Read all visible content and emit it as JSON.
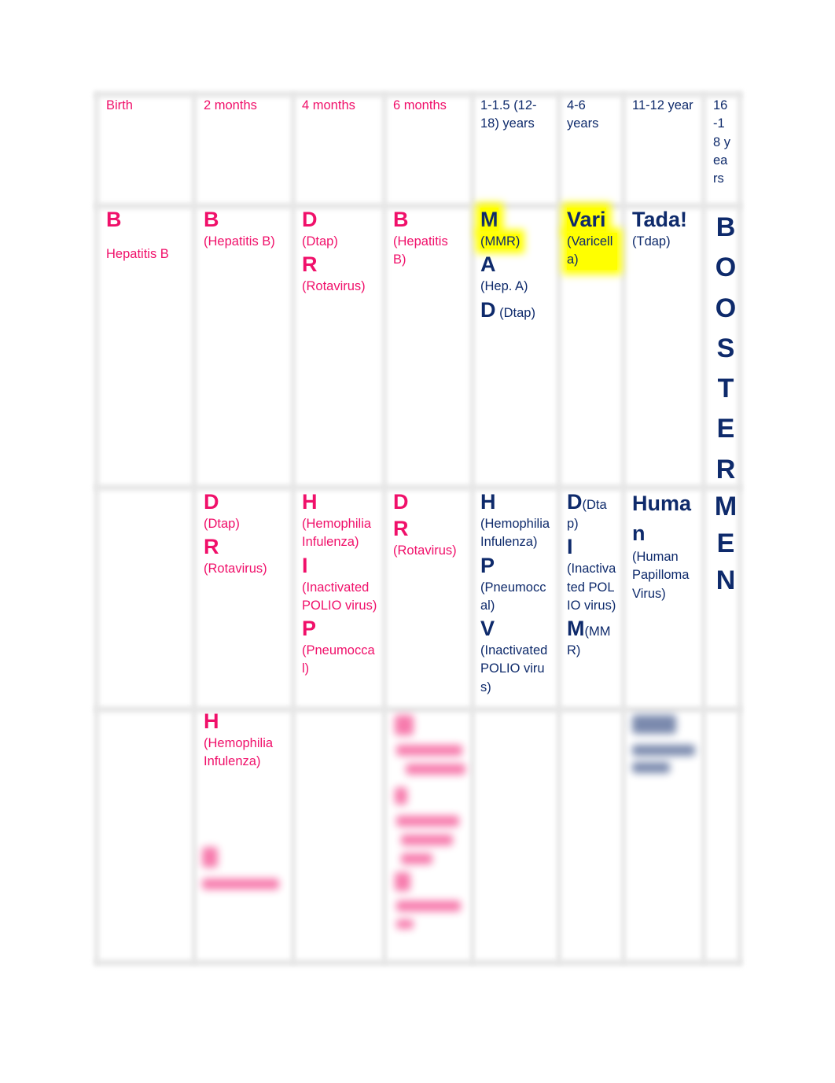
{
  "colors": {
    "pink": "#F0106A",
    "navy": "#0E2A6B",
    "highlight": "#FFFF00",
    "grid": "#E6E6E6"
  },
  "headers": [
    "Birth",
    "2 months",
    "4 months",
    "6 months",
    "1-1.5 (12-18) years",
    "4-6 years",
    "11-12 year",
    "16-18 years"
  ],
  "row1": {
    "birth": {
      "letter": "B",
      "name": "Hepatitis B"
    },
    "m2": {
      "letter": "B",
      "name": "(Hepatitis B)"
    },
    "m4": [
      {
        "letter": "D",
        "name": "(Dtap)"
      },
      {
        "letter": "R",
        "name": "(Rotavirus)"
      }
    ],
    "m6": {
      "letter": "B",
      "name": "(Hepatitis B)"
    },
    "y1": [
      {
        "letter": "M",
        "name": "(MMR)",
        "highlighted": true
      },
      {
        "letter": "A",
        "name": "(Hep. A)"
      },
      {
        "letter": "D",
        "name": "(Dtap)"
      }
    ],
    "y4": {
      "letter": "Vari",
      "name": "(Varicella)",
      "highlighted": true
    },
    "y11": {
      "letter": "Tada!",
      "name": "(Tdap)"
    }
  },
  "booster_letters": [
    "B",
    "O",
    "O",
    "S",
    "T",
    "E",
    "R",
    "M",
    "E",
    "N"
  ],
  "row2": {
    "m2": [
      {
        "letter": "D",
        "name": "(Dtap)"
      },
      {
        "letter": "R",
        "name": "(Rotavirus)"
      }
    ],
    "m4": [
      {
        "letter": "H",
        "name": "(Hemophilia Infulenza)"
      },
      {
        "letter": "I",
        "name": "(Inactivated POLIO virus)"
      },
      {
        "letter": "P",
        "name": "(Pneumoccal)"
      }
    ],
    "m6": [
      {
        "letter": "D",
        "name": ""
      },
      {
        "letter": "R",
        "name": "(Rotavirus)"
      }
    ],
    "y1": [
      {
        "letter": "H",
        "name": "(Hemophilia Infulenza)"
      },
      {
        "letter": "P",
        "name": "(Pneumoccal)"
      },
      {
        "letter": "V",
        "name": "(Inactivated POLIO virus)"
      }
    ],
    "y4": [
      {
        "letter": "D",
        "name": "(Dtap)"
      },
      {
        "letter": "I",
        "name": "(Inactivated POLIO virus)"
      },
      {
        "letter": "M",
        "name": "(MMR)"
      }
    ],
    "y11": {
      "letter": "Human",
      "name": "(Human Papilloma Virus)"
    }
  },
  "row3": {
    "m2": [
      {
        "letter": "H",
        "name": "(Hemophilia Infulenza)"
      }
    ]
  }
}
